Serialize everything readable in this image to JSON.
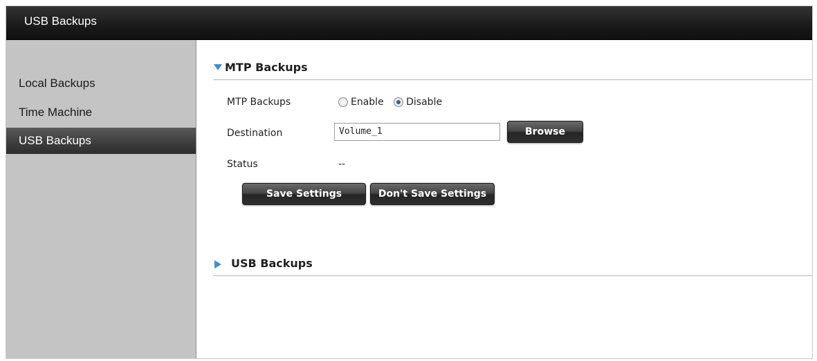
{
  "window": {
    "title": "USB Backups"
  },
  "sidebar": {
    "items": [
      {
        "label": "Local Backups",
        "active": false
      },
      {
        "label": "Time Machine",
        "active": false
      },
      {
        "label": "USB Backups",
        "active": true
      }
    ]
  },
  "mtp_section": {
    "header": "MTP Backups",
    "expanded": true,
    "backups_label": "MTP Backups",
    "enable_label": "Enable",
    "disable_label": "Disable",
    "selected": "Disable",
    "destination_label": "Destination",
    "destination_value": "Volume_1",
    "browse_label": "Browse",
    "status_label": "Status",
    "status_value": "--",
    "save_label": "Save Settings",
    "dont_save_label": "Don't Save Settings"
  },
  "usb_section": {
    "header": "USB Backups",
    "expanded": false
  },
  "colors": {
    "accent_arrow": "#3d8fd6",
    "titlebar": "#1c1c1c",
    "sidebar_bg": "#c4c4c4",
    "sidebar_active": "#3c3c3c"
  },
  "icons": {
    "expanded_arrow": "triangle-down-icon",
    "collapsed_arrow": "triangle-right-icon"
  }
}
